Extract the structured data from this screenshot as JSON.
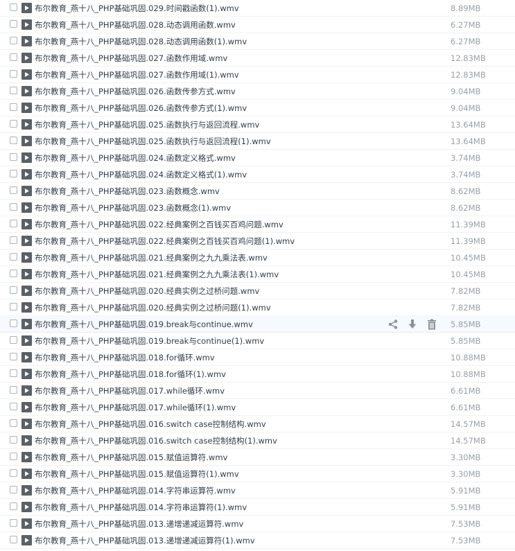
{
  "files": [
    {
      "name": "布尔教育_燕十八_PHP基础巩固.029.时间戳函数(1).wmv",
      "size": "8.89MB"
    },
    {
      "name": "布尔教育_燕十八_PHP基础巩固.028.动态调用函数.wmv",
      "size": "6.27MB"
    },
    {
      "name": "布尔教育_燕十八_PHP基础巩固.028.动态调用函数(1).wmv",
      "size": "6.27MB"
    },
    {
      "name": "布尔教育_燕十八_PHP基础巩固.027.函数作用域.wmv",
      "size": "12.83MB"
    },
    {
      "name": "布尔教育_燕十八_PHP基础巩固.027.函数作用域(1).wmv",
      "size": "12.83MB"
    },
    {
      "name": "布尔教育_燕十八_PHP基础巩固.026.函数传参方式.wmv",
      "size": "9.04MB"
    },
    {
      "name": "布尔教育_燕十八_PHP基础巩固.026.函数传参方式(1).wmv",
      "size": "9.04MB"
    },
    {
      "name": "布尔教育_燕十八_PHP基础巩固.025.函数执行与返回流程.wmv",
      "size": "13.64MB"
    },
    {
      "name": "布尔教育_燕十八_PHP基础巩固.025.函数执行与返回流程(1).wmv",
      "size": "13.64MB"
    },
    {
      "name": "布尔教育_燕十八_PHP基础巩固.024.函数定义格式.wmv",
      "size": "3.74MB"
    },
    {
      "name": "布尔教育_燕十八_PHP基础巩固.024.函数定义格式(1).wmv",
      "size": "3.74MB"
    },
    {
      "name": "布尔教育_燕十八_PHP基础巩固.023.函数概念.wmv",
      "size": "8.62MB"
    },
    {
      "name": "布尔教育_燕十八_PHP基础巩固.023.函数概念(1).wmv",
      "size": "8.62MB"
    },
    {
      "name": "布尔教育_燕十八_PHP基础巩固.022.经典案例之百钱买百鸡问题.wmv",
      "size": "11.39MB"
    },
    {
      "name": "布尔教育_燕十八_PHP基础巩固.022.经典案例之百钱买百鸡问题(1).wmv",
      "size": "11.39MB"
    },
    {
      "name": "布尔教育_燕十八_PHP基础巩固.021.经典案例之九九乘法表.wmv",
      "size": "10.45MB"
    },
    {
      "name": "布尔教育_燕十八_PHP基础巩固.021.经典案例之九九乘法表(1).wmv",
      "size": "10.45MB"
    },
    {
      "name": "布尔教育_燕十八_PHP基础巩固.020.经典实例之过桥问题.wmv",
      "size": "7.82MB"
    },
    {
      "name": "布尔教育_燕十八_PHP基础巩固.020.经典实例之过桥问题(1).wmv",
      "size": "7.82MB"
    },
    {
      "name": "布尔教育_燕十八_PHP基础巩固.019.break与continue.wmv",
      "size": "5.85MB",
      "hover": true
    },
    {
      "name": "布尔教育_燕十八_PHP基础巩固.019.break与continue(1).wmv",
      "size": "5.85MB"
    },
    {
      "name": "布尔教育_燕十八_PHP基础巩固.018.for循环.wmv",
      "size": "10.88MB"
    },
    {
      "name": "布尔教育_燕十八_PHP基础巩固.018.for循环(1).wmv",
      "size": "10.88MB"
    },
    {
      "name": "布尔教育_燕十八_PHP基础巩固.017.while循环.wmv",
      "size": "6.61MB"
    },
    {
      "name": "布尔教育_燕十八_PHP基础巩固.017.while循环(1).wmv",
      "size": "6.61MB"
    },
    {
      "name": "布尔教育_燕十八_PHP基础巩固.016.switch case控制结构.wmv",
      "size": "14.57MB"
    },
    {
      "name": "布尔教育_燕十八_PHP基础巩固.016.switch case控制结构(1).wmv",
      "size": "14.57MB"
    },
    {
      "name": "布尔教育_燕十八_PHP基础巩固.015.赋值运算符.wmv",
      "size": "3.30MB"
    },
    {
      "name": "布尔教育_燕十八_PHP基础巩固.015.赋值运算符(1).wmv",
      "size": "3.30MB"
    },
    {
      "name": "布尔教育_燕十八_PHP基础巩固.014.字符串运算符.wmv",
      "size": "5.91MB"
    },
    {
      "name": "布尔教育_燕十八_PHP基础巩固.014.字符串运算符(1).wmv",
      "size": "5.91MB"
    },
    {
      "name": "布尔教育_燕十八_PHP基础巩固.013.递增递减运算符.wmv",
      "size": "7.53MB"
    },
    {
      "name": "布尔教育_燕十八_PHP基础巩固.013.递增递减运算符(1).wmv",
      "size": "7.53MB"
    }
  ],
  "row_actions": [
    {
      "icon": "share-icon"
    },
    {
      "icon": "download-icon"
    },
    {
      "icon": "trash-icon"
    }
  ],
  "colors": {
    "icon": "#8c9199",
    "file_icon_bg": "#5b5f66",
    "size_text": "#9aa0a8",
    "hover_row": "#f6f9fd"
  }
}
